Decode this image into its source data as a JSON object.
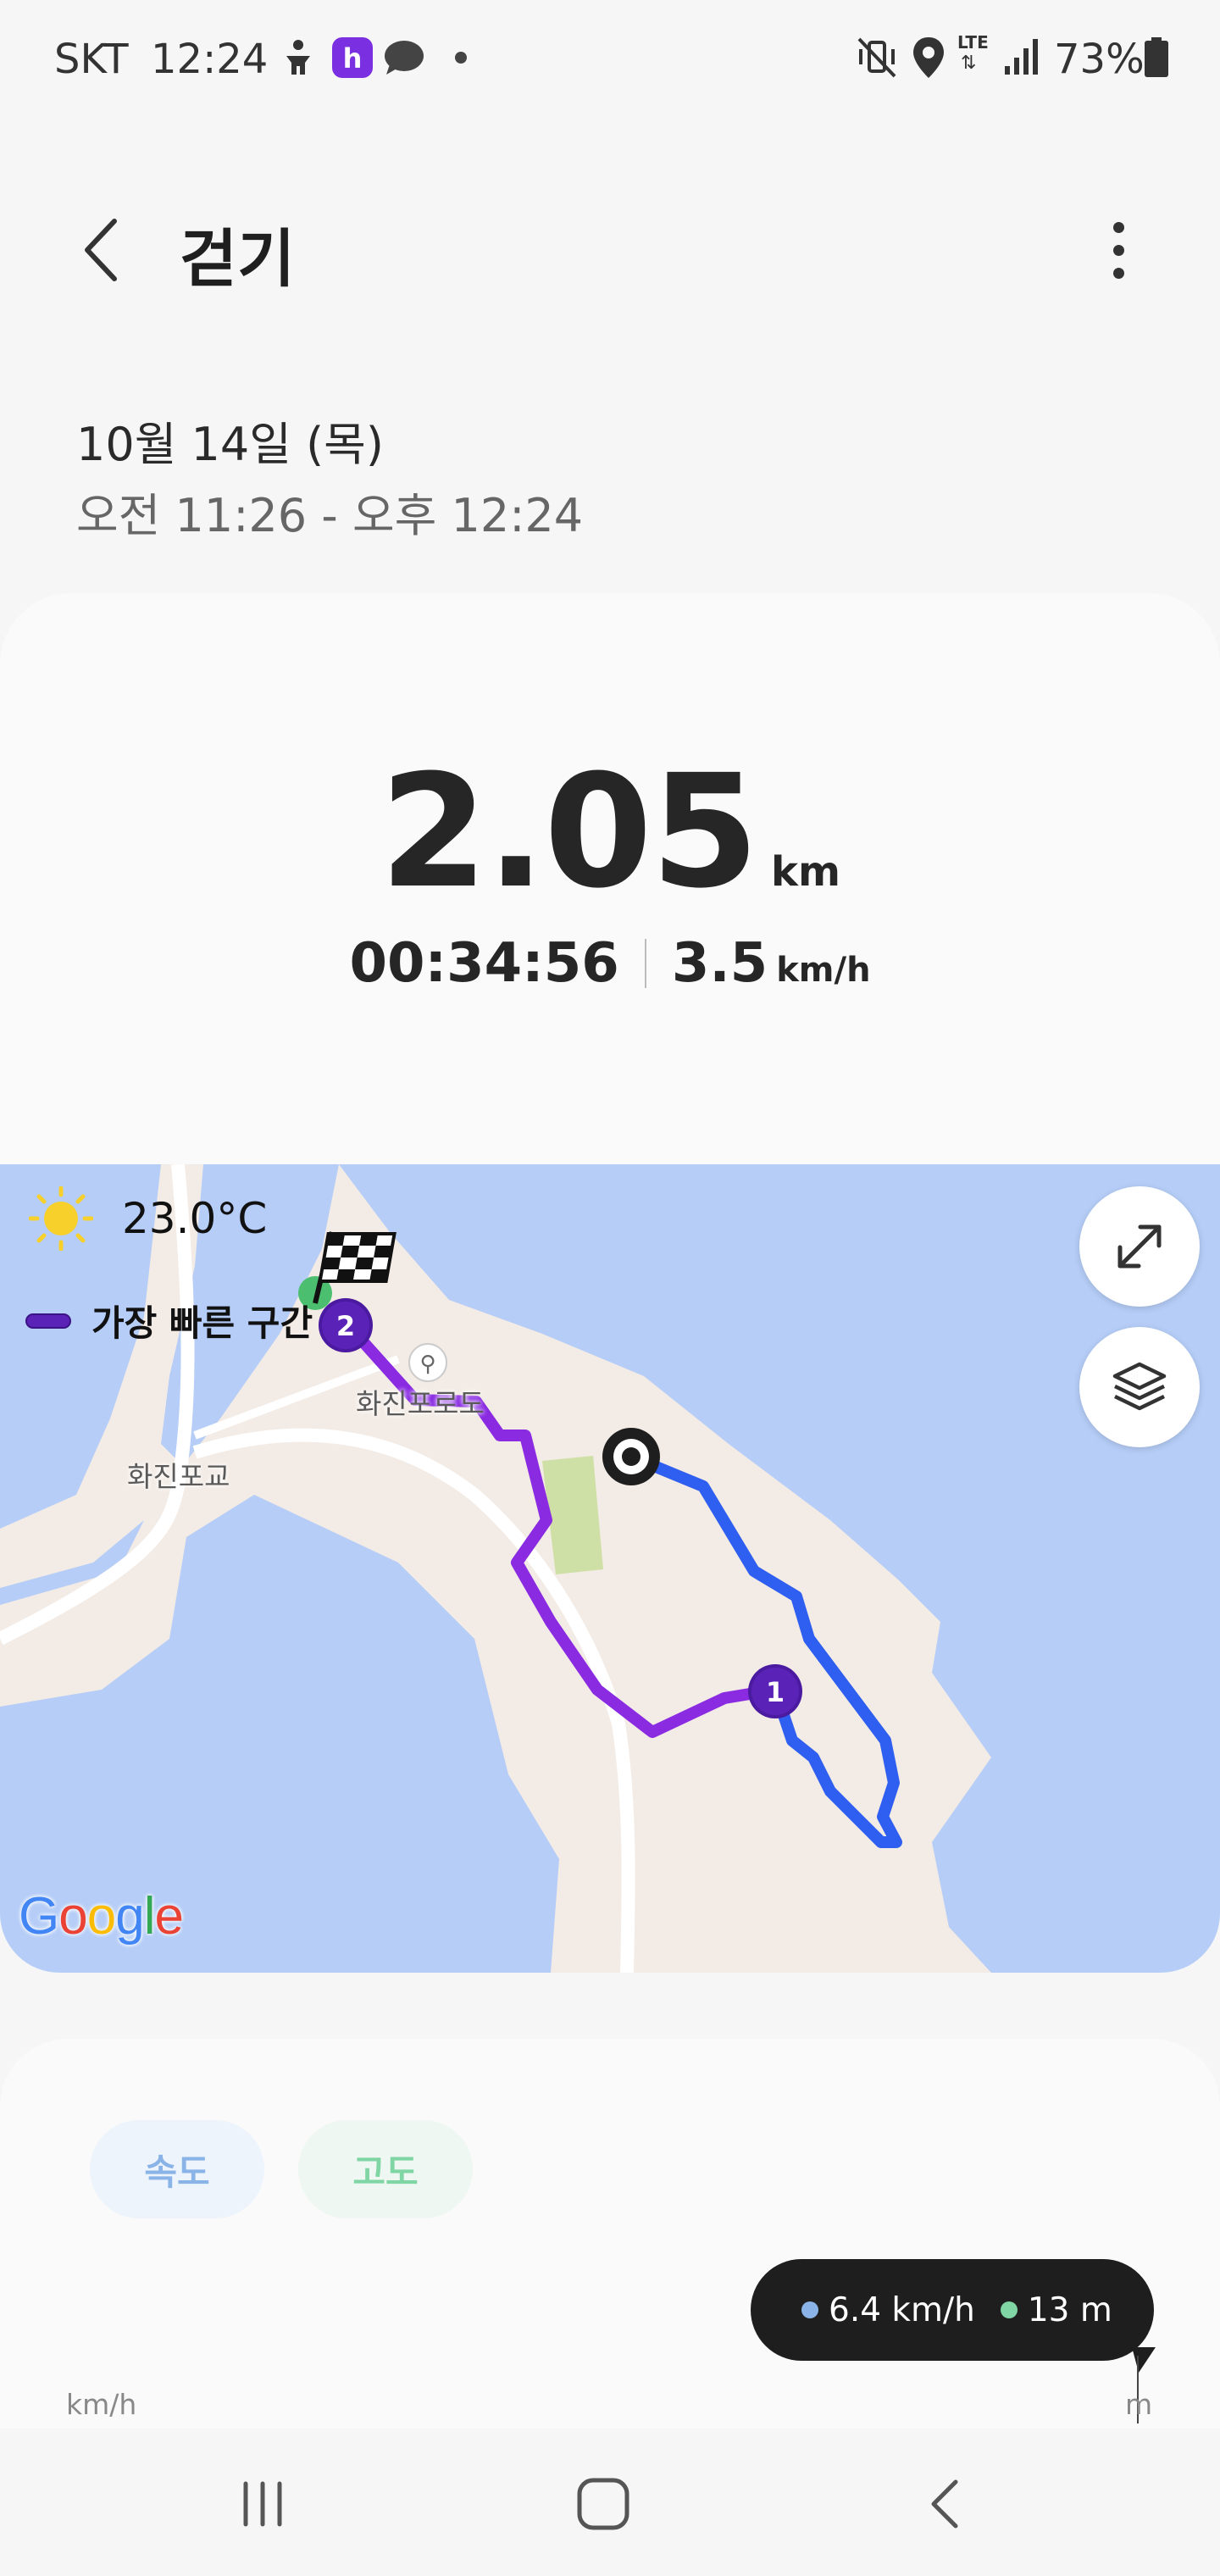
{
  "status_bar": {
    "carrier": "SKT",
    "time": "12:24",
    "network": "LTE",
    "battery": "73%",
    "icons": [
      "accessibility-icon",
      "health-app-icon",
      "chat-icon",
      "notification-dot-icon",
      "mute-vibrate-icon",
      "location-icon",
      "lte-icon",
      "signal-icon",
      "battery-icon"
    ]
  },
  "header": {
    "title": "걷기",
    "back_icon": "chevron-left-icon",
    "more_icon": "more-vertical-icon"
  },
  "session": {
    "date": "10월 14일 (목)",
    "time_range": "오전 11:26 - 오후 12:24"
  },
  "summary": {
    "distance": "2.05",
    "distance_unit": "km",
    "duration": "00:34:56",
    "avg_speed": "3.5",
    "speed_unit": "km/h"
  },
  "map": {
    "weather_icon": "sun-icon",
    "temperature": "23.0°C",
    "legend_label": "가장 빠른 구간",
    "legend_color": "#5b22b7",
    "place_labels": [
      "화진포교",
      "화진포로도"
    ],
    "markers": [
      "1",
      "2"
    ],
    "route_color_fast": "#8a2be2",
    "route_color_normal": "#2f5ff0",
    "water_color": "#b5cdf7",
    "land_color": "#f3ebe5",
    "park_color": "#cfe0a6",
    "attribution": "Google",
    "expand_icon": "expand-arrows-icon",
    "layers_icon": "layers-icon",
    "finish_icon": "checkered-flag-icon",
    "start_icon": "start-marker-icon"
  },
  "chart_tabs": {
    "speed_label": "속도",
    "altitude_label": "고도",
    "speed_color": "#8ab4e8",
    "altitude_color": "#7fd6a4"
  },
  "tooltip": {
    "speed": "6.4 km/h",
    "altitude": "13 m"
  },
  "axis": {
    "left_unit": "km/h",
    "right_unit": "m"
  },
  "nav": {
    "recents_icon": "recents-icon",
    "home_icon": "home-icon",
    "back_icon": "back-icon"
  }
}
